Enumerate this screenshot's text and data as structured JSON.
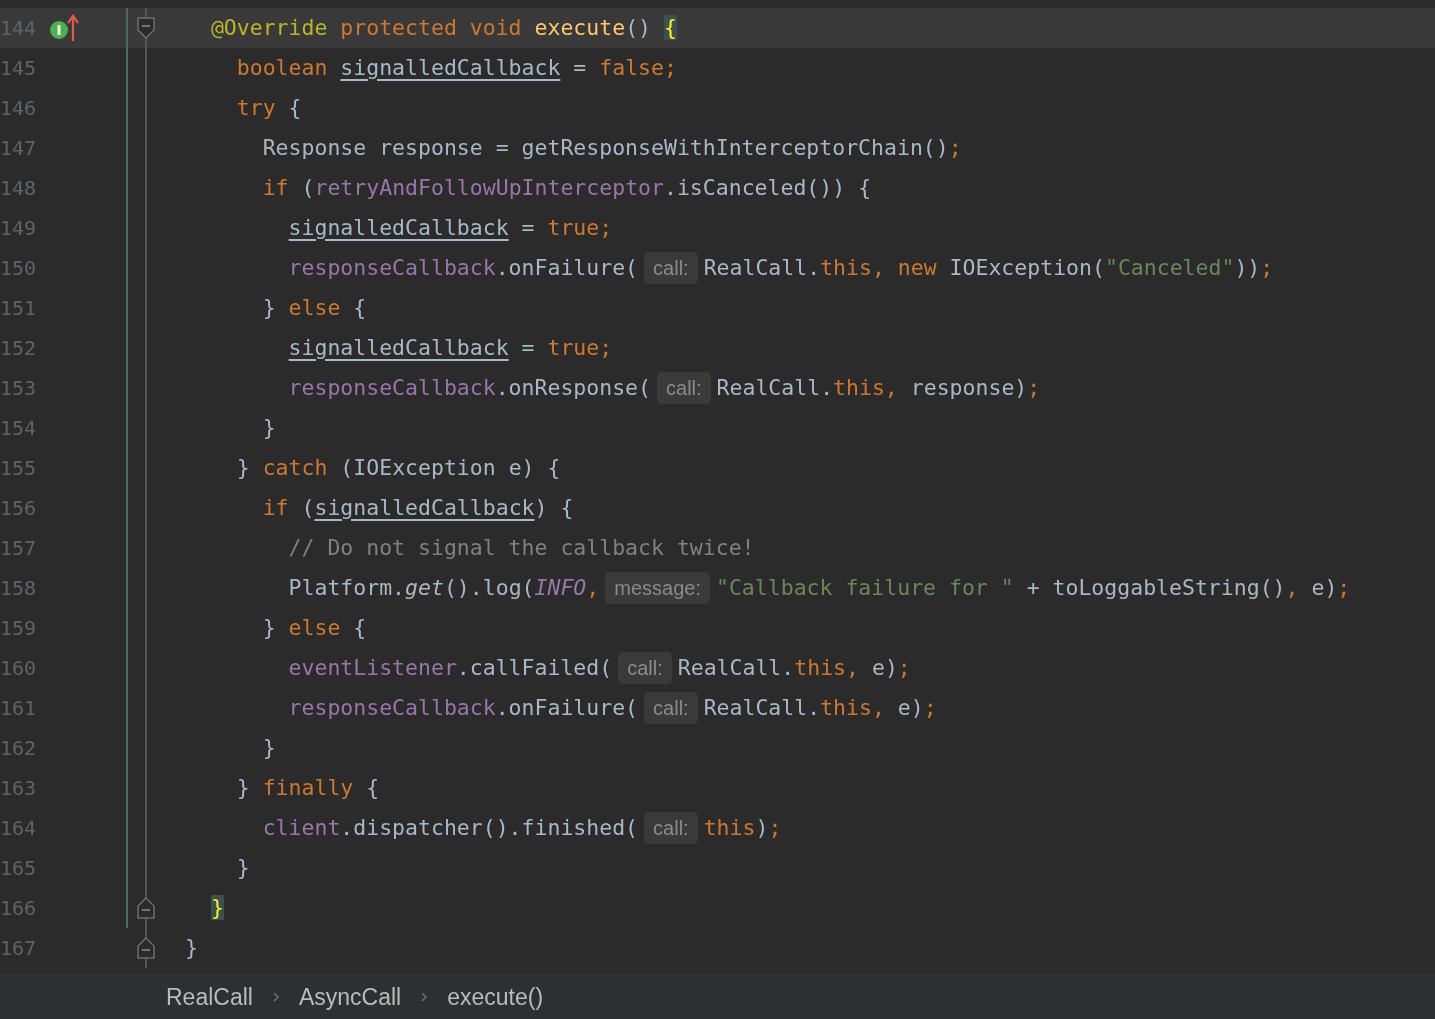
{
  "editor": {
    "lines": [
      {
        "number": "144",
        "current": true,
        "changed": true,
        "implemented": true,
        "fold_start": true,
        "fold_end": false,
        "tokens": [
          {
            "kind": "annotation",
            "text": "  @Override"
          },
          {
            "kind": "keyword",
            "text": " protected void "
          },
          {
            "kind": "method",
            "text": "execute"
          },
          {
            "kind": "plain",
            "text": "() "
          },
          {
            "kind": "brace",
            "text": "{"
          }
        ]
      },
      {
        "number": "145",
        "current": false,
        "changed": true,
        "implemented": false,
        "fold_start": false,
        "fold_end": false,
        "tokens": [
          {
            "kind": "keyword",
            "text": "    boolean "
          },
          {
            "kind": "var",
            "text": "signalledCallback"
          },
          {
            "kind": "plain",
            "text": " = "
          },
          {
            "kind": "keyword",
            "text": "false;"
          }
        ]
      },
      {
        "number": "146",
        "current": false,
        "changed": true,
        "implemented": false,
        "fold_start": false,
        "fold_end": false,
        "tokens": [
          {
            "kind": "keyword",
            "text": "    try"
          },
          {
            "kind": "plain",
            "text": " {"
          }
        ]
      },
      {
        "number": "147",
        "current": false,
        "changed": true,
        "implemented": false,
        "fold_start": false,
        "fold_end": false,
        "tokens": [
          {
            "kind": "plain",
            "text": "      Response response = getResponseWithInterceptorChain()"
          },
          {
            "kind": "keyword",
            "text": ";"
          }
        ]
      },
      {
        "number": "148",
        "current": false,
        "changed": true,
        "implemented": false,
        "fold_start": false,
        "fold_end": false,
        "tokens": [
          {
            "kind": "keyword",
            "text": "      if"
          },
          {
            "kind": "plain",
            "text": " ("
          },
          {
            "kind": "field",
            "text": "retryAndFollowUpInterceptor"
          },
          {
            "kind": "plain",
            "text": ".isCanceled()) {"
          }
        ]
      },
      {
        "number": "149",
        "current": false,
        "changed": true,
        "implemented": false,
        "fold_start": false,
        "fold_end": false,
        "tokens": [
          {
            "kind": "var",
            "text": "        signalledCallback"
          },
          {
            "kind": "plain",
            "text": " = "
          },
          {
            "kind": "keyword",
            "text": "true;"
          }
        ]
      },
      {
        "number": "150",
        "current": false,
        "changed": true,
        "implemented": false,
        "fold_start": false,
        "fold_end": false,
        "tokens": [
          {
            "kind": "field",
            "text": "        responseCallback"
          },
          {
            "kind": "plain",
            "text": ".onFailure("
          },
          {
            "kind": "hint",
            "text": "call:"
          },
          {
            "kind": "plain",
            "text": "RealCall."
          },
          {
            "kind": "keyword",
            "text": "this, new "
          },
          {
            "kind": "plain",
            "text": "IOException("
          },
          {
            "kind": "string",
            "text": "\"Canceled\""
          },
          {
            "kind": "plain",
            "text": "))"
          },
          {
            "kind": "keyword",
            "text": ";"
          }
        ]
      },
      {
        "number": "151",
        "current": false,
        "changed": true,
        "implemented": false,
        "fold_start": false,
        "fold_end": false,
        "tokens": [
          {
            "kind": "plain",
            "text": "      } "
          },
          {
            "kind": "keyword",
            "text": "else"
          },
          {
            "kind": "plain",
            "text": " {"
          }
        ]
      },
      {
        "number": "152",
        "current": false,
        "changed": true,
        "implemented": false,
        "fold_start": false,
        "fold_end": false,
        "tokens": [
          {
            "kind": "var",
            "text": "        signalledCallback"
          },
          {
            "kind": "plain",
            "text": " = "
          },
          {
            "kind": "keyword",
            "text": "true;"
          }
        ]
      },
      {
        "number": "153",
        "current": false,
        "changed": true,
        "implemented": false,
        "fold_start": false,
        "fold_end": false,
        "tokens": [
          {
            "kind": "field",
            "text": "        responseCallback"
          },
          {
            "kind": "plain",
            "text": ".onResponse("
          },
          {
            "kind": "hint",
            "text": "call:"
          },
          {
            "kind": "plain",
            "text": "RealCall."
          },
          {
            "kind": "keyword",
            "text": "this,"
          },
          {
            "kind": "plain",
            "text": " response)"
          },
          {
            "kind": "keyword",
            "text": ";"
          }
        ]
      },
      {
        "number": "154",
        "current": false,
        "changed": true,
        "implemented": false,
        "fold_start": false,
        "fold_end": false,
        "tokens": [
          {
            "kind": "plain",
            "text": "      }"
          }
        ]
      },
      {
        "number": "155",
        "current": false,
        "changed": true,
        "implemented": false,
        "fold_start": false,
        "fold_end": false,
        "tokens": [
          {
            "kind": "plain",
            "text": "    } "
          },
          {
            "kind": "keyword",
            "text": "catch"
          },
          {
            "kind": "plain",
            "text": " (IOException e) {"
          }
        ]
      },
      {
        "number": "156",
        "current": false,
        "changed": true,
        "implemented": false,
        "fold_start": false,
        "fold_end": false,
        "tokens": [
          {
            "kind": "keyword",
            "text": "      if"
          },
          {
            "kind": "plain",
            "text": " ("
          },
          {
            "kind": "var",
            "text": "signalledCallback"
          },
          {
            "kind": "plain",
            "text": ") {"
          }
        ]
      },
      {
        "number": "157",
        "current": false,
        "changed": true,
        "implemented": false,
        "fold_start": false,
        "fold_end": false,
        "tokens": [
          {
            "kind": "comment",
            "text": "        // Do not signal the callback twice!"
          }
        ]
      },
      {
        "number": "158",
        "current": false,
        "changed": true,
        "implemented": false,
        "fold_start": false,
        "fold_end": false,
        "tokens": [
          {
            "kind": "plain",
            "text": "        Platform."
          },
          {
            "kind": "static_method",
            "text": "get"
          },
          {
            "kind": "plain",
            "text": "().log("
          },
          {
            "kind": "constant",
            "text": "INFO"
          },
          {
            "kind": "keyword",
            "text": ","
          },
          {
            "kind": "hint",
            "text": "message:"
          },
          {
            "kind": "string",
            "text": "\"Callback failure for \""
          },
          {
            "kind": "plain",
            "text": " + toLoggableString()"
          },
          {
            "kind": "keyword",
            "text": ","
          },
          {
            "kind": "plain",
            "text": " e)"
          },
          {
            "kind": "keyword",
            "text": ";"
          }
        ]
      },
      {
        "number": "159",
        "current": false,
        "changed": true,
        "implemented": false,
        "fold_start": false,
        "fold_end": false,
        "tokens": [
          {
            "kind": "plain",
            "text": "      } "
          },
          {
            "kind": "keyword",
            "text": "else"
          },
          {
            "kind": "plain",
            "text": " {"
          }
        ]
      },
      {
        "number": "160",
        "current": false,
        "changed": true,
        "implemented": false,
        "fold_start": false,
        "fold_end": false,
        "tokens": [
          {
            "kind": "field",
            "text": "        eventListener"
          },
          {
            "kind": "plain",
            "text": ".callFailed("
          },
          {
            "kind": "hint",
            "text": "call:"
          },
          {
            "kind": "plain",
            "text": "RealCall."
          },
          {
            "kind": "keyword",
            "text": "this,"
          },
          {
            "kind": "plain",
            "text": " e)"
          },
          {
            "kind": "keyword",
            "text": ";"
          }
        ]
      },
      {
        "number": "161",
        "current": false,
        "changed": true,
        "implemented": false,
        "fold_start": false,
        "fold_end": false,
        "tokens": [
          {
            "kind": "field",
            "text": "        responseCallback"
          },
          {
            "kind": "plain",
            "text": ".onFailure("
          },
          {
            "kind": "hint",
            "text": "call:"
          },
          {
            "kind": "plain",
            "text": "RealCall."
          },
          {
            "kind": "keyword",
            "text": "this,"
          },
          {
            "kind": "plain",
            "text": " e)"
          },
          {
            "kind": "keyword",
            "text": ";"
          }
        ]
      },
      {
        "number": "162",
        "current": false,
        "changed": true,
        "implemented": false,
        "fold_start": false,
        "fold_end": false,
        "tokens": [
          {
            "kind": "plain",
            "text": "      }"
          }
        ]
      },
      {
        "number": "163",
        "current": false,
        "changed": true,
        "implemented": false,
        "fold_start": false,
        "fold_end": false,
        "tokens": [
          {
            "kind": "plain",
            "text": "    } "
          },
          {
            "kind": "keyword",
            "text": "finally"
          },
          {
            "kind": "plain",
            "text": " {"
          }
        ]
      },
      {
        "number": "164",
        "current": false,
        "changed": true,
        "implemented": false,
        "fold_start": false,
        "fold_end": false,
        "tokens": [
          {
            "kind": "field",
            "text": "      client"
          },
          {
            "kind": "plain",
            "text": ".dispatcher().finished("
          },
          {
            "kind": "hint",
            "text": "call:"
          },
          {
            "kind": "keyword",
            "text": "this"
          },
          {
            "kind": "plain",
            "text": ")"
          },
          {
            "kind": "keyword",
            "text": ";"
          }
        ]
      },
      {
        "number": "165",
        "current": false,
        "changed": true,
        "implemented": false,
        "fold_start": false,
        "fold_end": false,
        "tokens": [
          {
            "kind": "plain",
            "text": "    }"
          }
        ]
      },
      {
        "number": "166",
        "current": false,
        "changed": true,
        "implemented": false,
        "fold_start": false,
        "fold_end": true,
        "tokens": [
          {
            "kind": "brace",
            "text": "  }"
          }
        ]
      },
      {
        "number": "167",
        "current": false,
        "changed": false,
        "implemented": false,
        "fold_start": false,
        "fold_end": true,
        "tokens": [
          {
            "kind": "plain",
            "text": "}"
          }
        ]
      }
    ]
  },
  "breadcrumbs": [
    "RealCall",
    "AsyncCall",
    "execute()"
  ]
}
